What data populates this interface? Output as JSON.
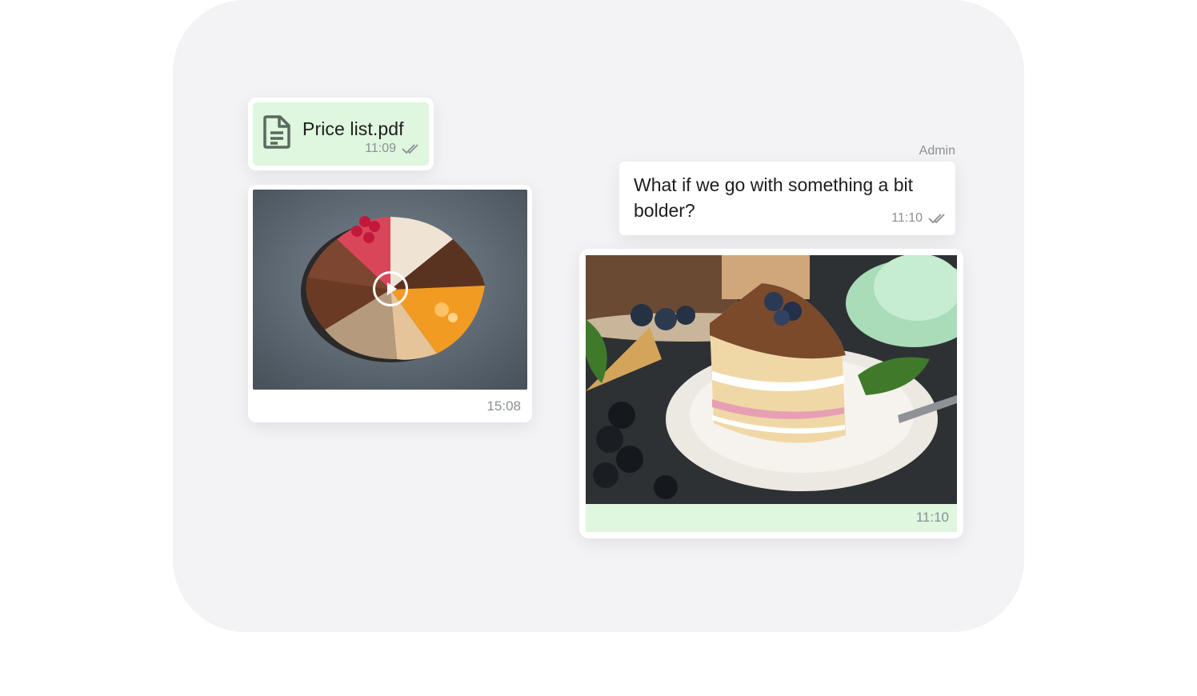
{
  "file_message": {
    "filename": "Price list.pdf",
    "time": "11:09",
    "icon": "document-icon",
    "status_icon": "double-check-icon"
  },
  "video_message": {
    "time": "15:08",
    "icon": "play-icon"
  },
  "admin_message": {
    "sender": "Admin",
    "text": "What if we go with something a bit bolder?",
    "time": "11:10",
    "status_icon": "double-check-icon"
  },
  "photo_message": {
    "time": "11:10"
  },
  "colors": {
    "panel_bg": "#f3f3f5",
    "bubble_green": "#dff6df",
    "bubble_white": "#ffffff",
    "meta_gray": "#8b8f95",
    "text_dark": "#1e1e1e",
    "icon_dark": "#5a6a5e"
  }
}
